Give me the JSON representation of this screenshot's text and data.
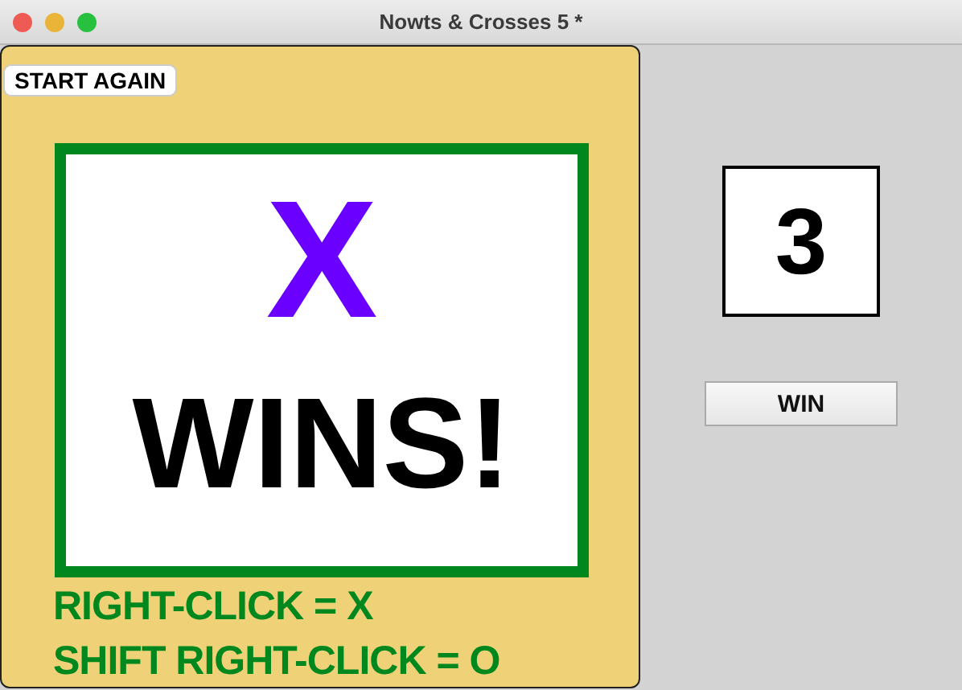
{
  "window": {
    "title": "Nowts & Crosses 5 *"
  },
  "board": {
    "start_button": "START AGAIN",
    "result": {
      "symbol": "X",
      "message": "WINS!"
    },
    "instructions": [
      "RIGHT-CLICK = X",
      "SHIFT RIGHT-CLICK = O"
    ]
  },
  "side": {
    "counter": "3",
    "win_button": "WIN"
  }
}
